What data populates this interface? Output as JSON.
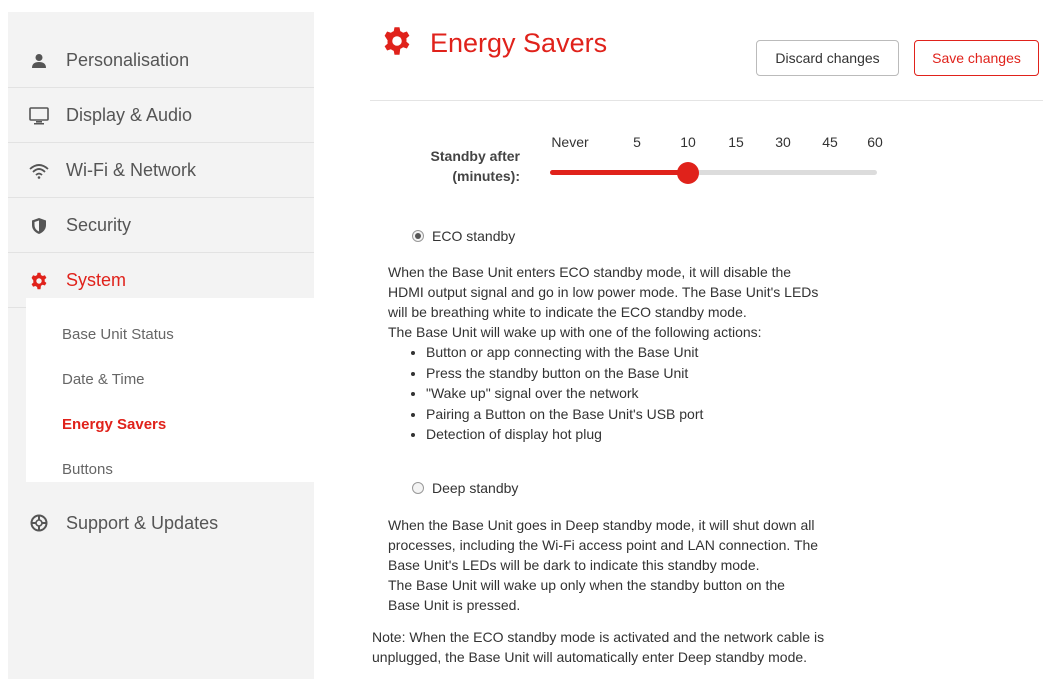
{
  "sidebar": {
    "items": [
      {
        "label": "Personalisation",
        "icon": "person-icon"
      },
      {
        "label": "Display & Audio",
        "icon": "monitor-icon"
      },
      {
        "label": "Wi-Fi & Network",
        "icon": "wifi-icon"
      },
      {
        "label": "Security",
        "icon": "shield-icon"
      },
      {
        "label": "System",
        "icon": "gear-icon"
      },
      {
        "label": "Support & Updates",
        "icon": "lifebuoy-icon"
      }
    ],
    "subitems": [
      {
        "label": "Base Unit Status"
      },
      {
        "label": "Date & Time"
      },
      {
        "label": "Energy Savers"
      },
      {
        "label": "Buttons"
      }
    ]
  },
  "header": {
    "title": "Energy Savers",
    "discard_label": "Discard changes",
    "save_label": "Save changes"
  },
  "standby": {
    "label_line1": "Standby after",
    "label_line2": "(minutes):",
    "ticks": [
      "Never",
      "5",
      "10",
      "15",
      "30",
      "45",
      "60"
    ],
    "selected_value": "10"
  },
  "eco": {
    "label": "ECO standby",
    "selected": true,
    "line1": "When the Base Unit enters ECO standby mode, it will disable the",
    "line2": "HDMI output signal and go in low power mode. The Base Unit's LEDs",
    "line3": "will be breathing white to indicate the ECO standby mode.",
    "line4": "The Base Unit will wake up with one of the following actions:",
    "actions": [
      "Button or app connecting with the Base Unit",
      "Press the standby button on the Base Unit",
      "\"Wake up\" signal over the network",
      "Pairing a Button on the Base Unit's USB port",
      "Detection of display hot plug"
    ]
  },
  "deep": {
    "label": "Deep standby",
    "selected": false,
    "line1": "When the Base Unit goes in Deep standby mode, it will shut down all",
    "line2": "processes, including the Wi-Fi access point and LAN connection. The",
    "line3": "Base Unit's LEDs will be dark to indicate this standby mode.",
    "line4": "The Base Unit will wake up only when the standby button on the",
    "line5": "Base Unit is pressed."
  },
  "note": {
    "line1": "Note: When the ECO standby mode is activated and the network cable is",
    "line2": "unplugged, the Base Unit will automatically enter Deep standby mode."
  },
  "colors": {
    "accent": "#e0221b",
    "sidebar_bg": "#f3f3f3"
  }
}
